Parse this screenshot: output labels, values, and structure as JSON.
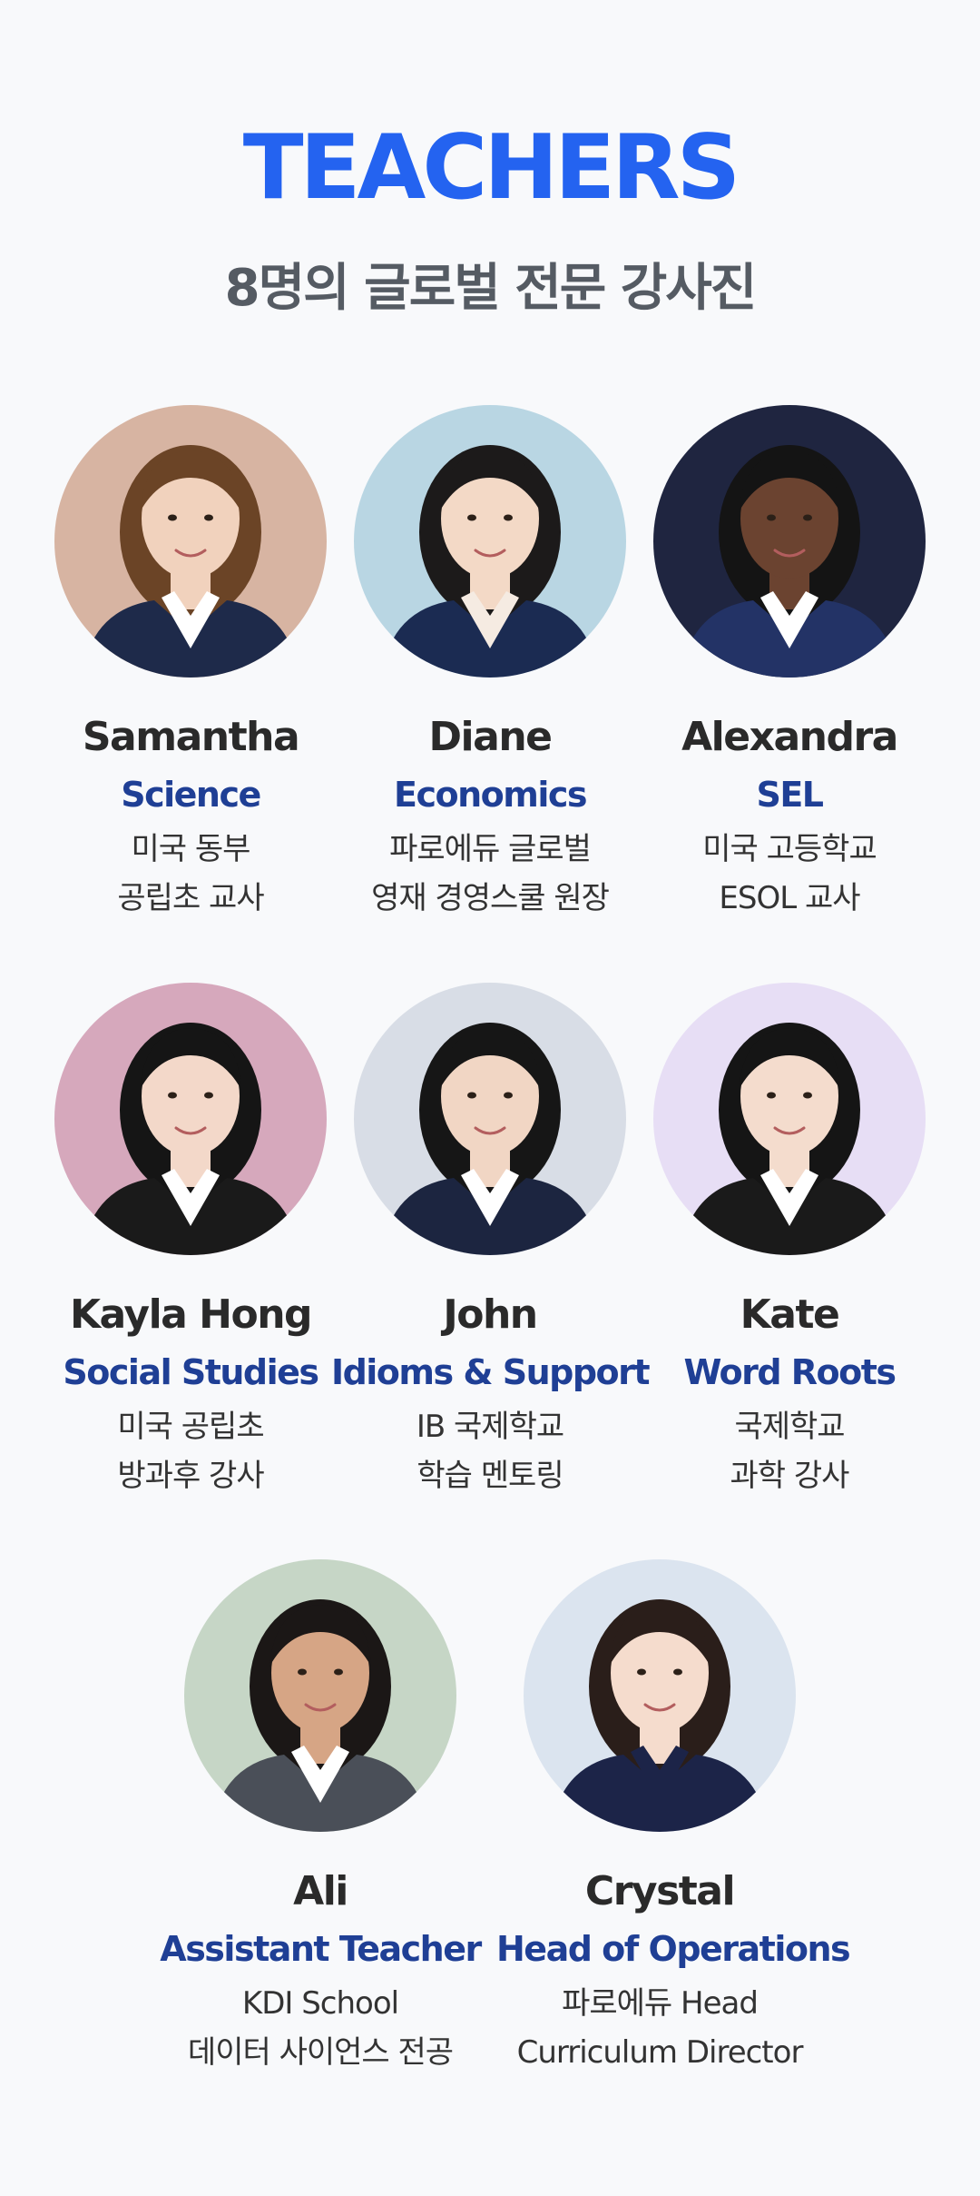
{
  "header": {
    "title": "TEACHERS",
    "subtitle": "8명의 글로벌 전문 강사진"
  },
  "teachers": [
    {
      "name": "Samantha",
      "role": "Science",
      "desc1": "미국 동부",
      "desc2": "공립초 교사",
      "bg": "#d7b4a2",
      "hair": "#6b4426",
      "skin": "#f1d2bd",
      "suit": "#1e2a4a",
      "shirt": "#ffffff"
    },
    {
      "name": "Diane",
      "role": "Economics",
      "desc1": "파로에듀 글로벌",
      "desc2": "영재 경영스쿨 원장",
      "bg": "#b9d6e3",
      "hair": "#1c1a1a",
      "skin": "#f3d9c6",
      "suit": "#1b2b52",
      "shirt": "#f5ebe2"
    },
    {
      "name": "Alexandra",
      "role": "SEL",
      "desc1": "미국 고등학교",
      "desc2": "ESOL 교사",
      "bg": "#1f2540",
      "hair": "#141414",
      "skin": "#6b4330",
      "suit": "#233366",
      "shirt": "#ffffff"
    },
    {
      "name": "Kayla Hong",
      "role": "Social Studies",
      "desc1": "미국 공립초",
      "desc2": "방과후 강사",
      "bg": "#d6a8bc",
      "hair": "#151515",
      "skin": "#f3d8c9",
      "suit": "#1a1a1a",
      "shirt": "#ffffff"
    },
    {
      "name": "John",
      "role": "Idioms & Support",
      "desc1": "IB 국제학교",
      "desc2": "학습 멘토링",
      "bg": "#d8dde6",
      "hair": "#161616",
      "skin": "#f1d6c4",
      "suit": "#1c2540",
      "shirt": "#ffffff"
    },
    {
      "name": "Kate",
      "role": "Word Roots",
      "desc1": "국제학교",
      "desc2": "과학 강사",
      "bg": "#e7def5",
      "hair": "#151515",
      "skin": "#f4dccd",
      "suit": "#1a1a1a",
      "shirt": "#ffffff"
    },
    {
      "name": "Ali",
      "role": "Assistant Teacher",
      "desc1": "KDI School",
      "desc2": "데이터 사이언스 전공",
      "bg": "#c6d6c6",
      "hair": "#1b1716",
      "skin": "#d6a585",
      "suit": "#4a4f58",
      "shirt": "#ffffff"
    },
    {
      "name": "Crystal",
      "role": "Head of Operations",
      "desc1": "파로에듀 Head",
      "desc2": "Curriculum Director",
      "bg": "#dbe4ef",
      "hair": "#2a1e1a",
      "skin": "#f5dccd",
      "suit": "#1c2448",
      "shirt": "#1c2448"
    }
  ]
}
